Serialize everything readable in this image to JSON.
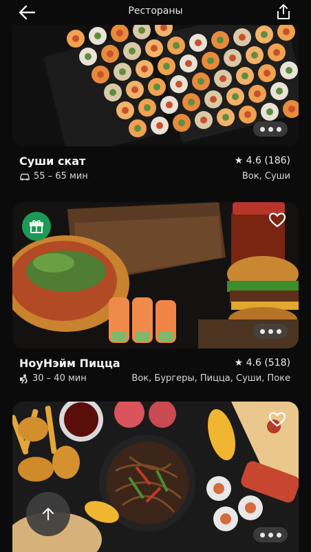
{
  "header": {
    "title": "Рестораны",
    "back_icon": "arrow-left-icon",
    "share_icon": "share-icon"
  },
  "restaurants": [
    {
      "name": "Суши скат",
      "rating": "★ 4.6 (186)",
      "delivery_time": "55 – 65 мин",
      "delivery_icon": "car-icon",
      "tags": "Вок, Суши",
      "carousel_pages": 3
    },
    {
      "name": "НоуНэйм Пицца",
      "rating": "★ 4.6 (518)",
      "delivery_time": "30 – 40 мин",
      "delivery_icon": "courier-icon",
      "tags": "Вок, Бургеры, Пицца, Суши, Поке",
      "badge_icon": "gift-icon",
      "favorite_icon": "heart-icon",
      "carousel_pages": 3
    },
    {
      "favorite_icon": "heart-icon",
      "carousel_pages": 3
    }
  ],
  "scroll_top_icon": "arrow-up-icon",
  "colors": {
    "background": "#0b0b0b",
    "gift_badge": "#1d9a55",
    "text": "#f2f2f2"
  }
}
